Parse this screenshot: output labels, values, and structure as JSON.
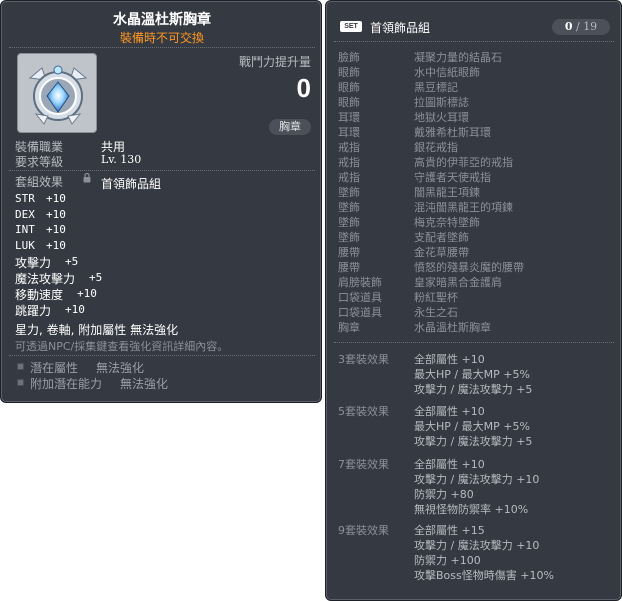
{
  "item": {
    "name": "水晶溫杜斯胸章",
    "trade_notice": "裝備時不可交換",
    "power_label": "戰鬥力提升量",
    "power_value": "0",
    "slot_type": "胸章",
    "job_label": "裝備職業",
    "job_value": "共用",
    "level_label": "要求等級",
    "level_value": "Lv. 130",
    "set_label": "套組效果",
    "set_value": "首領飾品組",
    "stats": [
      {
        "name": "STR",
        "value": "+10"
      },
      {
        "name": "DEX",
        "value": "+10"
      },
      {
        "name": "INT",
        "value": "+10"
      },
      {
        "name": "LUK",
        "value": "+10"
      },
      {
        "name": "攻擊力",
        "value": "+5"
      },
      {
        "name": "魔法攻擊力",
        "value": "+5"
      },
      {
        "name": "移動速度",
        "value": "+10"
      },
      {
        "name": "跳躍力",
        "value": "+10"
      }
    ],
    "note_bold": "星力, 卷軸, 附加屬性 無法強化",
    "note_small": "可透過NPC/採集鍵查看強化資訊詳細內容。",
    "potential": [
      {
        "label": "潛在屬性",
        "value": "無法強化"
      },
      {
        "label": "附加潛在能力",
        "value": "無法強化"
      }
    ],
    "icon": "crystal-badge-icon"
  },
  "set_panel": {
    "tag": "SET",
    "name": "首領飾品組",
    "owned": "0",
    "separator": "/",
    "total": "19",
    "pieces": [
      {
        "slot": "臉飾",
        "name": "凝聚力量的結晶石"
      },
      {
        "slot": "眼飾",
        "name": "水中信紙眼飾"
      },
      {
        "slot": "眼飾",
        "name": "黑豆標記"
      },
      {
        "slot": "眼飾",
        "name": "拉圖斯標誌"
      },
      {
        "slot": "耳環",
        "name": "地獄火耳環"
      },
      {
        "slot": "耳環",
        "name": "戴雅希杜斯耳環"
      },
      {
        "slot": "戒指",
        "name": "銀花戒指"
      },
      {
        "slot": "戒指",
        "name": "高貴的伊菲亞的戒指"
      },
      {
        "slot": "戒指",
        "name": "守護者天使戒指"
      },
      {
        "slot": "墜飾",
        "name": "闇黑龍王項鍊"
      },
      {
        "slot": "墜飾",
        "name": "混沌闇黑龍王的項鍊"
      },
      {
        "slot": "墜飾",
        "name": "梅克奈特墜飾"
      },
      {
        "slot": "墜飾",
        "name": "支配者墜飾"
      },
      {
        "slot": "腰帶",
        "name": "金花草腰帶"
      },
      {
        "slot": "腰帶",
        "name": "憤怒的殘暴炎魔的腰帶"
      },
      {
        "slot": "肩膀裝飾",
        "name": "皇家暗黑合金護肩"
      },
      {
        "slot": "口袋道具",
        "name": "粉紅聖杯"
      },
      {
        "slot": "口袋道具",
        "name": "永生之石"
      },
      {
        "slot": "胸章",
        "name": "水晶溫杜斯胸章"
      }
    ],
    "bonuses": [
      {
        "tier": "3套裝效果",
        "lines": [
          "全部屬性 +10",
          "最大HP / 最大MP  +5%",
          "攻擊力 / 魔法攻擊力  +5"
        ]
      },
      {
        "tier": "5套裝效果",
        "lines": [
          "全部屬性 +10",
          "最大HP / 最大MP  +5%",
          "攻擊力 / 魔法攻擊力  +5"
        ]
      },
      {
        "tier": "7套裝效果",
        "lines": [
          "全部屬性 +10",
          "攻擊力 / 魔法攻擊力  +10",
          "防禦力  +80",
          "無視怪物防禦率 +10%"
        ]
      },
      {
        "tier": "9套裝效果",
        "lines": [
          "全部屬性 +15",
          "攻擊力 / 魔法攻擊力  +10",
          "防禦力  +100",
          "攻擊Boss怪物時傷害 +10%"
        ]
      }
    ]
  }
}
